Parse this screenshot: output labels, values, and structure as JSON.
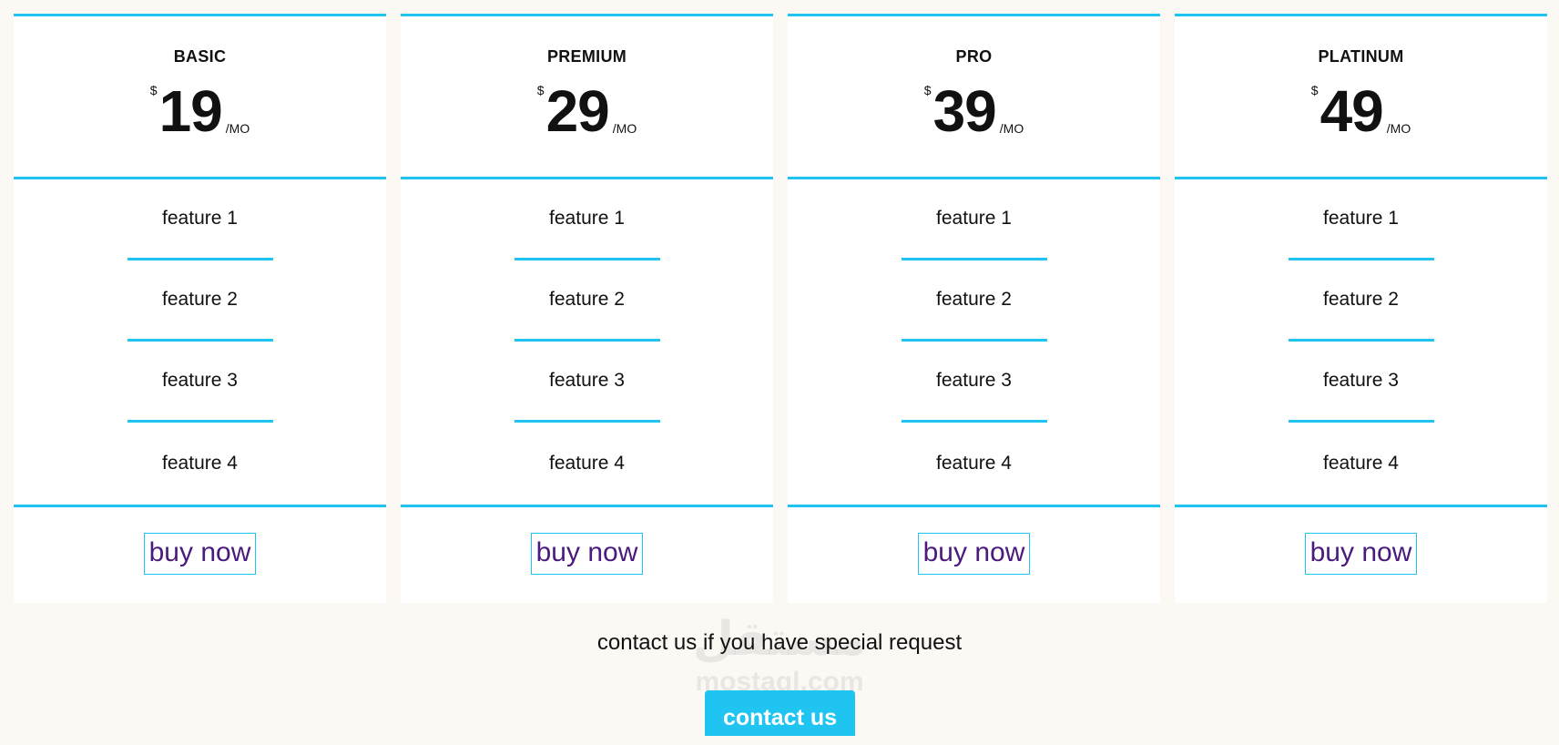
{
  "plans": [
    {
      "name": "BASIC",
      "currency": "$",
      "amount": "19",
      "period": "/MO",
      "features": [
        "feature 1",
        "feature 2",
        "feature 3",
        "feature 4"
      ],
      "button": "buy now"
    },
    {
      "name": "PREMIUM",
      "currency": "$",
      "amount": "29",
      "period": "/MO",
      "features": [
        "feature 1",
        "feature 2",
        "feature 3",
        "feature 4"
      ],
      "button": "buy now"
    },
    {
      "name": "PRO",
      "currency": "$",
      "amount": "39",
      "period": "/MO",
      "features": [
        "feature 1",
        "feature 2",
        "feature 3",
        "feature 4"
      ],
      "button": "buy now"
    },
    {
      "name": "PLATINUM",
      "currency": "$",
      "amount": "49",
      "period": "/MO",
      "features": [
        "feature 1",
        "feature 2",
        "feature 3",
        "feature 4"
      ],
      "button": "buy now"
    }
  ],
  "contact": {
    "text": "contact us if you have special request",
    "button": "contact us"
  },
  "watermark": {
    "arabic": "مستقل",
    "latin": "mostaql.com"
  },
  "colors": {
    "accent": "#1fc4f0",
    "link": "#4a1a7c",
    "background": "#fcf9f4"
  }
}
